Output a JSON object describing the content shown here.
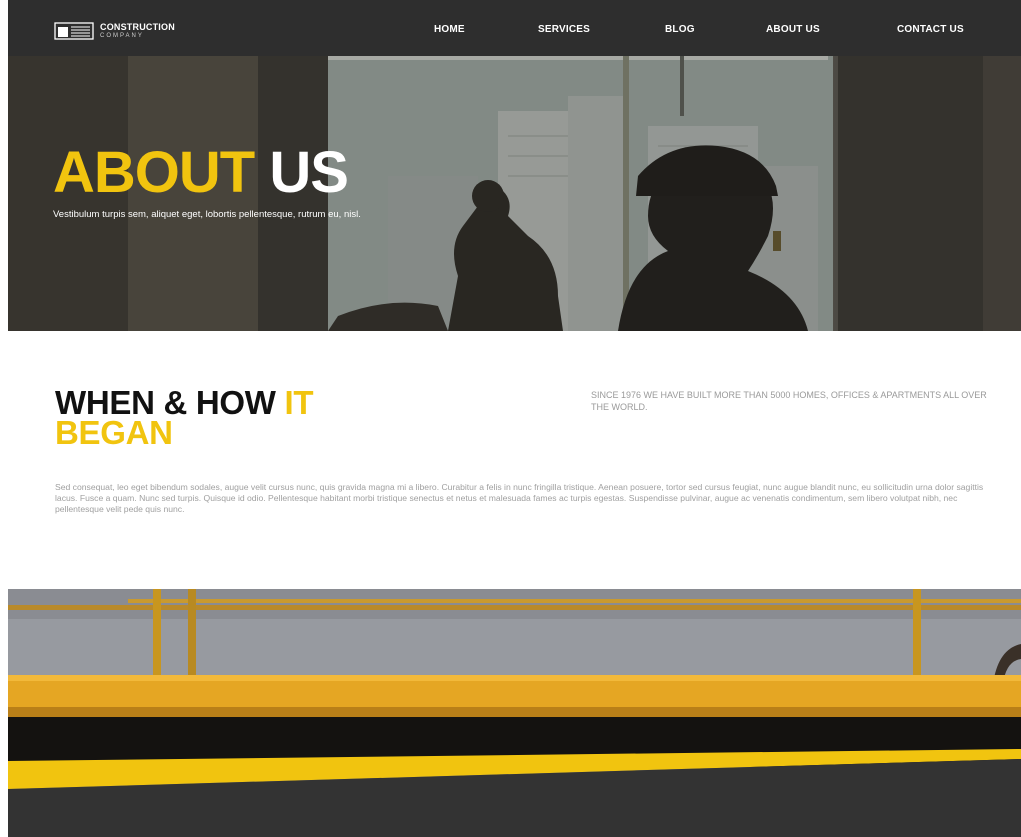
{
  "brand": {
    "name": "CONSTRUCTION",
    "sub": "COMPANY",
    "logo_icon": "building-logo-icon"
  },
  "nav": {
    "items": [
      {
        "label": "HOME"
      },
      {
        "label": "SERVICES"
      },
      {
        "label": "BLOG"
      },
      {
        "label": "ABOUT US"
      },
      {
        "label": "CONTACT US"
      }
    ]
  },
  "hero": {
    "title_accent": "ABOUT",
    "title_rest": " US",
    "subtitle": "Vestibulum turpis sem, aliquet eget, lobortis pellentesque, rutrum eu, nisl."
  },
  "about": {
    "heading_line1": "WHEN & HOW ",
    "heading_accent1": "IT",
    "heading_accent2": "BEGAN",
    "since": "SINCE 1976 WE HAVE BUILT MORE THAN 5000 HOMES, OFFICES & APARTMENTS ALL OVER THE WORLD.",
    "body": "Sed consequat, leo eget bibendum sodales, augue velit cursus nunc, quis gravida magna mi a libero. Curabitur a felis in nunc fringilla tristique. Aenean posuere, tortor sed cursus feugiat, nunc augue blandit nunc, eu sollicitudin urna dolor sagittis lacus. Fusce a quam. Nunc sed turpis. Quisque id odio. Pellentesque habitant morbi tristique senectus et netus et malesuada fames ac turpis egestas. Suspendisse pulvinar, augue ac venenatis condimentum, sem libero volutpat nibh, nec pellentesque velit pede quis nunc."
  },
  "colors": {
    "accent": "#f1c40f",
    "nav_bg": "#2e2e2e",
    "dark": "#333333"
  }
}
